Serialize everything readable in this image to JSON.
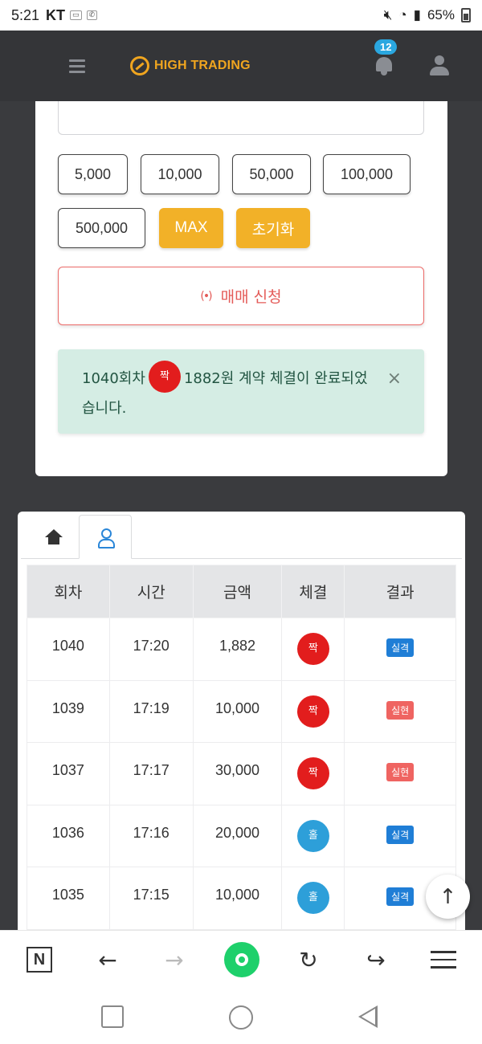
{
  "status_bar": {
    "time": "5:21",
    "carrier": "KT",
    "battery": "65%",
    "icons": [
      "muted-icon",
      "wifi-icon",
      "signal-icon",
      "battery-icon"
    ]
  },
  "header": {
    "logo_text": "HIGH TRADING",
    "notification_count": "12",
    "brand_color": "#f0a51f"
  },
  "trade": {
    "amount_buttons": [
      "5,000",
      "10,000",
      "50,000",
      "100,000",
      "500,000"
    ],
    "max_label": "MAX",
    "reset_label": "초기화",
    "submit_label": "매매 신청",
    "alert": {
      "prefix": "1040회차",
      "chip": "짝",
      "suffix": "1882원 계약 체결이 완료되었습니다.",
      "close": "×"
    }
  },
  "history": {
    "columns": [
      "회차",
      "시간",
      "금액",
      "체결",
      "결과"
    ],
    "rows": [
      {
        "round": "1040",
        "time": "17:20",
        "amount": "1,882",
        "chip": "짝",
        "chip_color": "#e21d1d",
        "result": "실격",
        "result_color": "#1f7ed6"
      },
      {
        "round": "1039",
        "time": "17:19",
        "amount": "10,000",
        "chip": "짝",
        "chip_color": "#e21d1d",
        "result": "실현",
        "result_color": "#ef6461"
      },
      {
        "round": "1037",
        "time": "17:17",
        "amount": "30,000",
        "chip": "짝",
        "chip_color": "#e21d1d",
        "result": "실현",
        "result_color": "#ef6461"
      },
      {
        "round": "1036",
        "time": "17:16",
        "amount": "20,000",
        "chip": "홀",
        "chip_color": "#2d9fd9",
        "result": "실격",
        "result_color": "#1f7ed6"
      },
      {
        "round": "1035",
        "time": "17:15",
        "amount": "10,000",
        "chip": "홀",
        "chip_color": "#2d9fd9",
        "result": "실격",
        "result_color": "#1f7ed6"
      }
    ]
  },
  "scroll_top": "↑",
  "browser_toolbar": {
    "n_label": "N",
    "back": "←",
    "forward": "→",
    "refresh": "↻",
    "share": "↪"
  }
}
